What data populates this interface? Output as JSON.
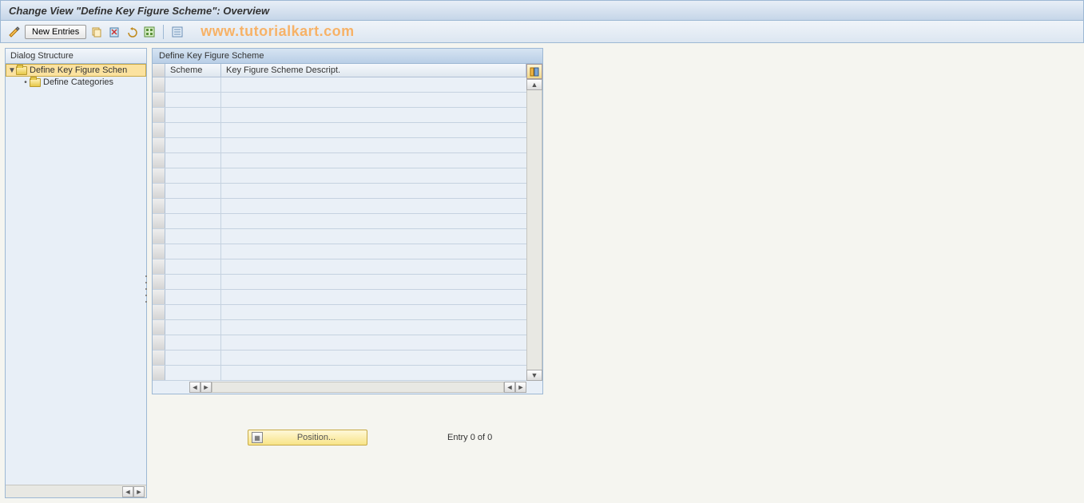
{
  "title": "Change View \"Define Key Figure Scheme\": Overview",
  "toolbar": {
    "new_entries": "New Entries"
  },
  "watermark": "www.tutorialkart.com",
  "sidebar": {
    "title": "Dialog Structure",
    "items": [
      {
        "label": "Define Key Figure Schen"
      },
      {
        "label": "Define Categories"
      }
    ]
  },
  "panel": {
    "title": "Define Key Figure Scheme",
    "columns": {
      "scheme": "Scheme",
      "desc": "Key Figure Scheme Descript."
    },
    "rows": [
      {},
      {},
      {},
      {},
      {},
      {},
      {},
      {},
      {},
      {},
      {},
      {},
      {},
      {},
      {},
      {},
      {},
      {},
      {},
      {}
    ]
  },
  "footer": {
    "position": "Position...",
    "entry": "Entry 0 of 0"
  }
}
